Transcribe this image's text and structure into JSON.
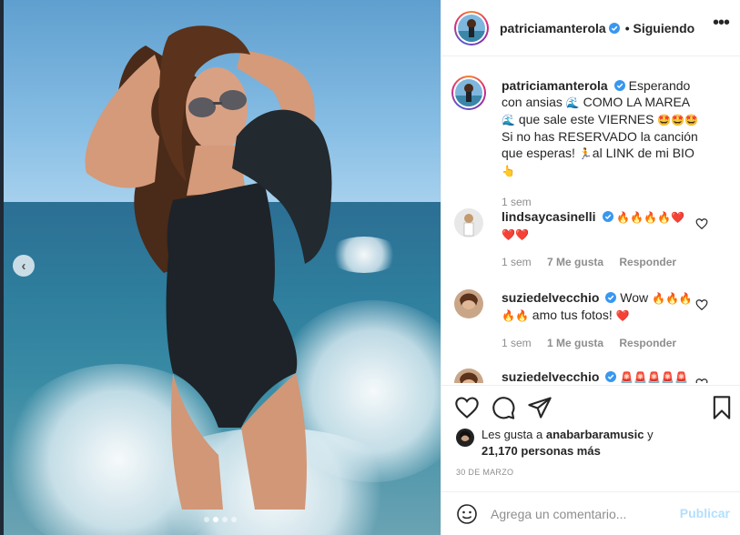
{
  "post": {
    "author": "patriciamanterola",
    "follow_status": "• Siguiendo",
    "more_label": "•••"
  },
  "caption": {
    "author": "patriciamanterola",
    "segments": [
      "Esperando con ansias",
      "COMO LA MAREA",
      "que sale este VIERNES",
      "Si no has RESERVADO la canción que esperas!",
      "al LINK de mi BIO"
    ],
    "time": "1 sem"
  },
  "comments": [
    {
      "author": "lindsaycasinelli",
      "time": "1 sem",
      "likes": "7 Me gusta",
      "reply": "Responder"
    },
    {
      "author": "suziedelvecchio",
      "text_1": "Wow",
      "text_2": "amo tus fotos!",
      "time": "1 sem",
      "likes": "1 Me gusta",
      "reply": "Responder"
    },
    {
      "author": "suziedelvecchio"
    }
  ],
  "likes_summary": {
    "prefix": "Les gusta a",
    "user": "anabarbaramusic",
    "joiner": "y",
    "count": "21,170 personas más"
  },
  "date": "30 DE MARZO",
  "add_comment": {
    "placeholder": "Agrega un comentario...",
    "publish": "Publicar"
  },
  "icons": {
    "like": "heart-icon",
    "comment": "comment-bubble-icon",
    "share": "paper-plane-icon",
    "save": "bookmark-icon",
    "emoji": "smiley-icon",
    "verified": "verified-badge-icon",
    "carousel_prev": "chevron-left-icon"
  },
  "colors": {
    "verified": "#3897f0",
    "publish_disabled": "#b2dffc",
    "muted_text": "#8e8e8e",
    "heart_red": "#e0245e"
  },
  "carousel": {
    "slide_count": 4,
    "active_index": 2
  }
}
